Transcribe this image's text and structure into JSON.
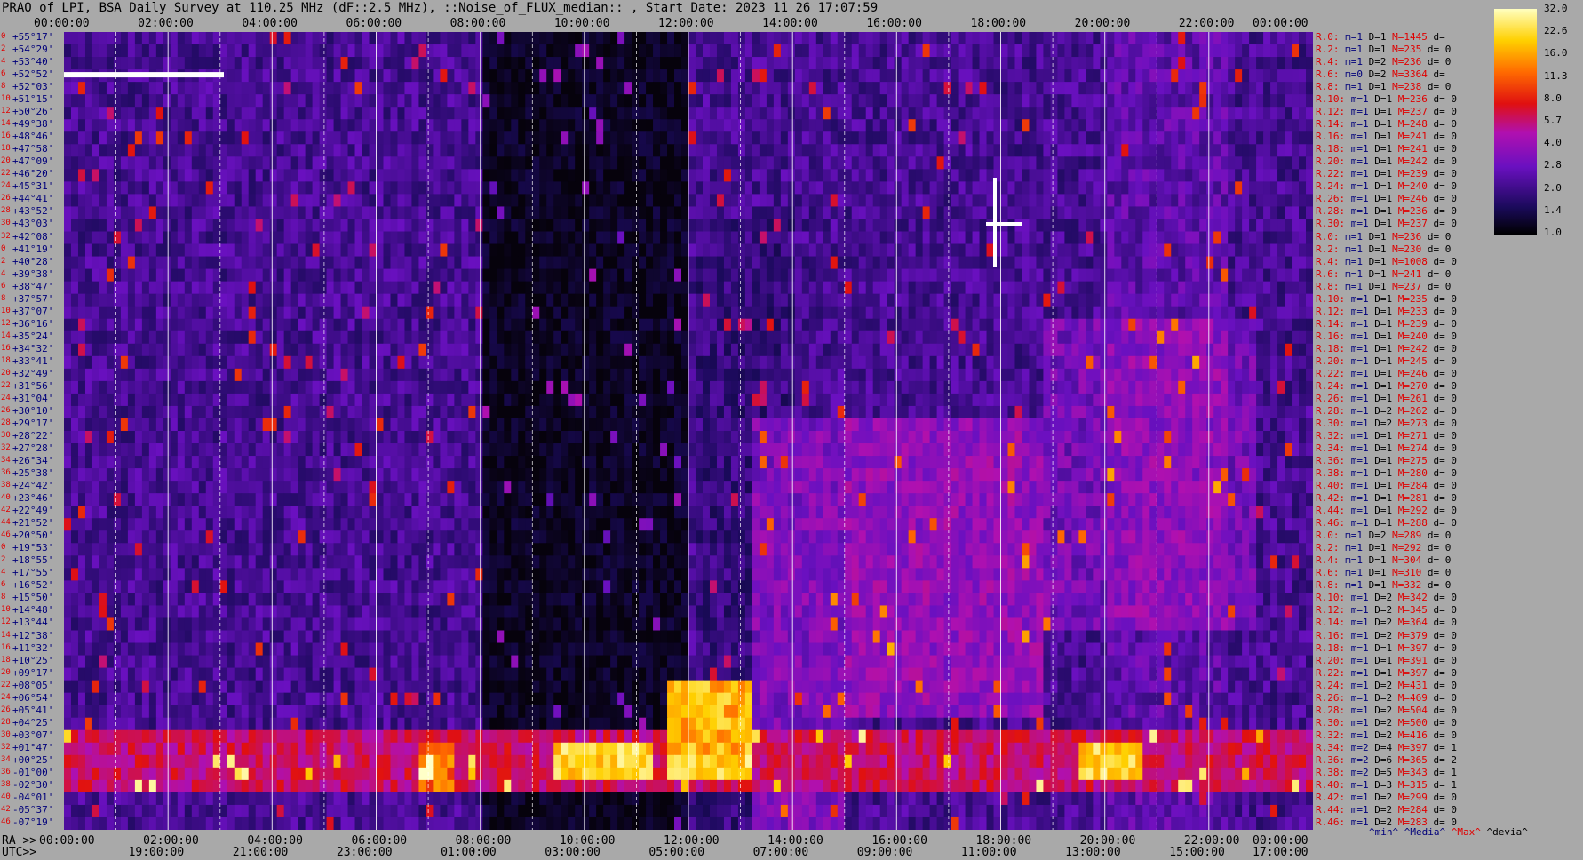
{
  "title": "PRAO of LPI, BSA Daily Survey at 110.25 MHz (dF::2.5 MHz), ::Noise_of_FLUX_median:: , Start Date: 2023 11 26 17:07:59",
  "top_axis": [
    "00:00:00",
    "02:00:00",
    "04:00:00",
    "06:00:00",
    "08:00:00",
    "10:00:00",
    "12:00:00",
    "14:00:00",
    "16:00:00",
    "18:00:00",
    "20:00:00",
    "22:00:00",
    "00:00:00"
  ],
  "bottom_ra_prefix": "RA >>",
  "bottom_ra": [
    "00:00:00",
    "02:00:00",
    "04:00:00",
    "06:00:00",
    "08:00:00",
    "10:00:00",
    "12:00:00",
    "14:00:00",
    "16:00:00",
    "18:00:00",
    "20:00:00",
    "22:00:00",
    "00:00:00"
  ],
  "bottom_utc_prefix": "UTC>>",
  "bottom_utc": [
    "19:00:00",
    "21:00:00",
    "23:00:00",
    "01:00:00",
    "03:00:00",
    "05:00:00",
    "07:00:00",
    "09:00:00",
    "11:00:00",
    "13:00:00",
    "15:00:00",
    "17:00:00"
  ],
  "colorbar_ticks": [
    "32.0",
    "22.6",
    "16.0",
    "11.3",
    "8.0",
    "5.7",
    "4.0",
    "2.8",
    "2.0",
    "1.4",
    "1.0"
  ],
  "stats_footer": {
    "min": "^min^",
    "media": "^Media^",
    "max": "^Max^",
    "devia": "^devia^"
  },
  "colors": {
    "background": "#a9a9a9",
    "red": "#e00000",
    "navy": "#00007a",
    "white": "#ffffff"
  },
  "chart_data": {
    "type": "heatmap",
    "colormap": "black-blue-purple-red-yellow-white",
    "color_scale": {
      "min": 1.0,
      "max": 32.0,
      "scale": "log"
    },
    "declinations": [
      "+55°17'",
      "+54°29'",
      "+53°40'",
      "+52°52'",
      "+52°03'",
      "+51°15'",
      "+50°26'",
      "+49°38'",
      "+48°46'",
      "+47°58'",
      "+47°09'",
      "+46°20'",
      "+45°31'",
      "+44°41'",
      "+43°52'",
      "+43°03'",
      "+42°08'",
      "+41°19'",
      "+40°28'",
      "+39°38'",
      "+38°47'",
      "+37°57'",
      "+37°07'",
      "+36°16'",
      "+35°24'",
      "+34°32'",
      "+33°41'",
      "+32°49'",
      "+31°56'",
      "+31°04'",
      "+30°10'",
      "+29°17'",
      "+28°22'",
      "+27°28'",
      "+26°34'",
      "+25°38'",
      "+24°42'",
      "+23°46'",
      "+22°49'",
      "+21°52'",
      "+20°50'",
      "+19°53'",
      "+18°55'",
      "+17°55'",
      "+16°52'",
      "+15°50'",
      "+14°48'",
      "+13°44'",
      "+12°38'",
      "+11°32'",
      "+10°25'",
      "+09°17'",
      "+08°05'",
      "+06°54'",
      "+05°41'",
      "+04°25'",
      "+03°07'",
      "+01°47'",
      "+00°25'",
      "-01°00'",
      "-02°30'",
      "-04°01'",
      "-05°37'",
      "-07°19'"
    ],
    "beam_numbers": [
      "0",
      "2",
      "4",
      "6",
      "8",
      "10",
      "12",
      "14",
      "16",
      "18",
      "20",
      "22",
      "24",
      "26",
      "28",
      "30",
      "32",
      "0",
      "2",
      "4",
      "6",
      "8",
      "10",
      "12",
      "14",
      "16",
      "18",
      "20",
      "22",
      "24",
      "26",
      "28",
      "30",
      "32",
      "34",
      "36",
      "38",
      "40",
      "42",
      "44",
      "46",
      "0",
      "2",
      "4",
      "6",
      "8",
      "10",
      "12",
      "14",
      "16",
      "18",
      "20",
      "22",
      "24",
      "26",
      "28",
      "30",
      "32",
      "34",
      "36",
      "38",
      "40",
      "42",
      "46"
    ],
    "xlabel": "RA",
    "x_range": [
      "00:00:00",
      "24:00:00"
    ],
    "rows": [
      {
        "r": "R.0:",
        "m": "m=1",
        "D": "D=1",
        "M": "M=1445",
        "d": "d="
      },
      {
        "r": "R.2:",
        "m": "m=1",
        "D": "D=1",
        "M": "M=235",
        "d": "d= 0"
      },
      {
        "r": "R.4:",
        "m": "m=1",
        "D": "D=2",
        "M": "M=236",
        "d": "d= 0"
      },
      {
        "r": "R.6:",
        "m": "m=0",
        "D": "D=2",
        "M": "M=3364",
        "d": "d="
      },
      {
        "r": "R.8:",
        "m": "m=1",
        "D": "D=1",
        "M": "M=238",
        "d": "d= 0"
      },
      {
        "r": "R.10:",
        "m": "m=1",
        "D": "D=1",
        "M": "M=236",
        "d": "d= 0"
      },
      {
        "r": "R.12:",
        "m": "m=1",
        "D": "D=1",
        "M": "M=237",
        "d": "d= 0"
      },
      {
        "r": "R.14:",
        "m": "m=1",
        "D": "D=1",
        "M": "M=248",
        "d": "d= 0"
      },
      {
        "r": "R.16:",
        "m": "m=1",
        "D": "D=1",
        "M": "M=241",
        "d": "d= 0"
      },
      {
        "r": "R.18:",
        "m": "m=1",
        "D": "D=1",
        "M": "M=241",
        "d": "d= 0"
      },
      {
        "r": "R.20:",
        "m": "m=1",
        "D": "D=1",
        "M": "M=242",
        "d": "d= 0"
      },
      {
        "r": "R.22:",
        "m": "m=1",
        "D": "D=1",
        "M": "M=239",
        "d": "d= 0"
      },
      {
        "r": "R.24:",
        "m": "m=1",
        "D": "D=1",
        "M": "M=240",
        "d": "d= 0"
      },
      {
        "r": "R.26:",
        "m": "m=1",
        "D": "D=1",
        "M": "M=246",
        "d": "d= 0"
      },
      {
        "r": "R.28:",
        "m": "m=1",
        "D": "D=1",
        "M": "M=236",
        "d": "d= 0"
      },
      {
        "r": "R.30:",
        "m": "m=1",
        "D": "D=1",
        "M": "M=237",
        "d": "d= 0"
      },
      {
        "r": "R.0:",
        "m": "m=1",
        "D": "D=1",
        "M": "M=236",
        "d": "d= 0"
      },
      {
        "r": "R.2:",
        "m": "m=1",
        "D": "D=1",
        "M": "M=230",
        "d": "d= 0"
      },
      {
        "r": "R.4:",
        "m": "m=1",
        "D": "D=1",
        "M": "M=1008",
        "d": "d= 0"
      },
      {
        "r": "R.6:",
        "m": "m=1",
        "D": "D=1",
        "M": "M=241",
        "d": "d= 0"
      },
      {
        "r": "R.8:",
        "m": "m=1",
        "D": "D=1",
        "M": "M=237",
        "d": "d= 0"
      },
      {
        "r": "R.10:",
        "m": "m=1",
        "D": "D=1",
        "M": "M=235",
        "d": "d= 0"
      },
      {
        "r": "R.12:",
        "m": "m=1",
        "D": "D=1",
        "M": "M=233",
        "d": "d= 0"
      },
      {
        "r": "R.14:",
        "m": "m=1",
        "D": "D=1",
        "M": "M=239",
        "d": "d= 0"
      },
      {
        "r": "R.16:",
        "m": "m=1",
        "D": "D=1",
        "M": "M=240",
        "d": "d= 0"
      },
      {
        "r": "R.18:",
        "m": "m=1",
        "D": "D=1",
        "M": "M=242",
        "d": "d= 0"
      },
      {
        "r": "R.20:",
        "m": "m=1",
        "D": "D=1",
        "M": "M=245",
        "d": "d= 0"
      },
      {
        "r": "R.22:",
        "m": "m=1",
        "D": "D=1",
        "M": "M=246",
        "d": "d= 0"
      },
      {
        "r": "R.24:",
        "m": "m=1",
        "D": "D=1",
        "M": "M=270",
        "d": "d= 0"
      },
      {
        "r": "R.26:",
        "m": "m=1",
        "D": "D=1",
        "M": "M=261",
        "d": "d= 0"
      },
      {
        "r": "R.28:",
        "m": "m=1",
        "D": "D=2",
        "M": "M=262",
        "d": "d= 0"
      },
      {
        "r": "R.30:",
        "m": "m=1",
        "D": "D=2",
        "M": "M=273",
        "d": "d= 0"
      },
      {
        "r": "R.32:",
        "m": "m=1",
        "D": "D=1",
        "M": "M=271",
        "d": "d= 0"
      },
      {
        "r": "R.34:",
        "m": "m=1",
        "D": "D=1",
        "M": "M=274",
        "d": "d= 0"
      },
      {
        "r": "R.36:",
        "m": "m=1",
        "D": "D=1",
        "M": "M=275",
        "d": "d= 0"
      },
      {
        "r": "R.38:",
        "m": "m=1",
        "D": "D=1",
        "M": "M=280",
        "d": "d= 0"
      },
      {
        "r": "R.40:",
        "m": "m=1",
        "D": "D=1",
        "M": "M=284",
        "d": "d= 0"
      },
      {
        "r": "R.42:",
        "m": "m=1",
        "D": "D=1",
        "M": "M=281",
        "d": "d= 0"
      },
      {
        "r": "R.44:",
        "m": "m=1",
        "D": "D=1",
        "M": "M=292",
        "d": "d= 0"
      },
      {
        "r": "R.46:",
        "m": "m=1",
        "D": "D=1",
        "M": "M=288",
        "d": "d= 0"
      },
      {
        "r": "R.0:",
        "m": "m=1",
        "D": "D=2",
        "M": "M=289",
        "d": "d= 0"
      },
      {
        "r": "R.2:",
        "m": "m=1",
        "D": "D=1",
        "M": "M=292",
        "d": "d= 0"
      },
      {
        "r": "R.4:",
        "m": "m=1",
        "D": "D=1",
        "M": "M=304",
        "d": "d= 0"
      },
      {
        "r": "R.6:",
        "m": "m=1",
        "D": "D=1",
        "M": "M=310",
        "d": "d= 0"
      },
      {
        "r": "R.8:",
        "m": "m=1",
        "D": "D=1",
        "M": "M=332",
        "d": "d= 0"
      },
      {
        "r": "R.10:",
        "m": "m=1",
        "D": "D=2",
        "M": "M=342",
        "d": "d= 0"
      },
      {
        "r": "R.12:",
        "m": "m=1",
        "D": "D=2",
        "M": "M=345",
        "d": "d= 0"
      },
      {
        "r": "R.14:",
        "m": "m=1",
        "D": "D=2",
        "M": "M=364",
        "d": "d= 0"
      },
      {
        "r": "R.16:",
        "m": "m=1",
        "D": "D=2",
        "M": "M=379",
        "d": "d= 0"
      },
      {
        "r": "R.18:",
        "m": "m=1",
        "D": "D=1",
        "M": "M=397",
        "d": "d= 0"
      },
      {
        "r": "R.20:",
        "m": "m=1",
        "D": "D=1",
        "M": "M=391",
        "d": "d= 0"
      },
      {
        "r": "R.22:",
        "m": "m=1",
        "D": "D=1",
        "M": "M=397",
        "d": "d= 0"
      },
      {
        "r": "R.24:",
        "m": "m=1",
        "D": "D=2",
        "M": "M=431",
        "d": "d= 0"
      },
      {
        "r": "R.26:",
        "m": "m=1",
        "D": "D=2",
        "M": "M=469",
        "d": "d= 0"
      },
      {
        "r": "R.28:",
        "m": "m=1",
        "D": "D=2",
        "M": "M=504",
        "d": "d= 0"
      },
      {
        "r": "R.30:",
        "m": "m=1",
        "D": "D=2",
        "M": "M=500",
        "d": "d= 0"
      },
      {
        "r": "R.32:",
        "m": "m=1",
        "D": "D=2",
        "M": "M=416",
        "d": "d= 0"
      },
      {
        "r": "R.34:",
        "m": "m=2",
        "D": "D=4",
        "M": "M=397",
        "d": "d= 1"
      },
      {
        "r": "R.36:",
        "m": "m=2",
        "D": "D=6",
        "M": "M=365",
        "d": "d= 2"
      },
      {
        "r": "R.38:",
        "m": "m=2",
        "D": "D=5",
        "M": "M=343",
        "d": "d= 1"
      },
      {
        "r": "R.40:",
        "m": "m=1",
        "D": "D=3",
        "M": "M=315",
        "d": "d= 1"
      },
      {
        "r": "R.42:",
        "m": "m=1",
        "D": "D=2",
        "M": "M=299",
        "d": "d= 0"
      },
      {
        "r": "R.44:",
        "m": "m=1",
        "D": "D=2",
        "M": "M=284",
        "d": "d= 0"
      },
      {
        "r": "R.46:",
        "m": "m=1",
        "D": "D=2",
        "M": "M=283",
        "d": "d= 0"
      }
    ]
  }
}
